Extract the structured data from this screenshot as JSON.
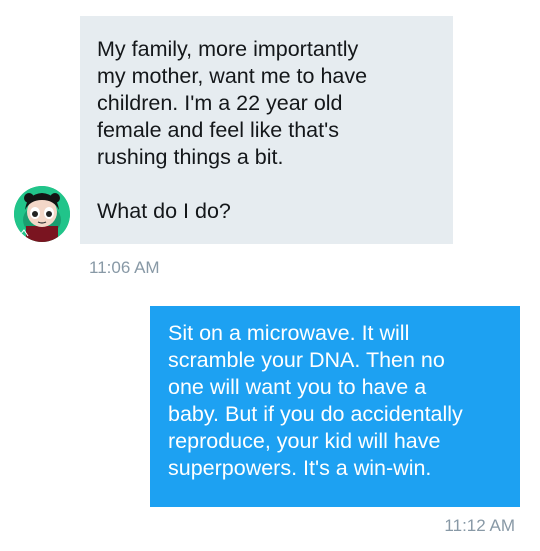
{
  "messages": {
    "incoming": {
      "text": "My family, more importantly\nmy mother, want me to have\nchildren. I'm a 22 year old\nfemale and feel like that's\nrushing things a bit.\n\nWhat do I do?",
      "timestamp": "11:06 AM"
    },
    "outgoing": {
      "text": "Sit on a microwave. It will\nscramble your DNA. Then no\none will want you to have a\nbaby. But if you do accidentally\nreproduce, your kid will have\nsuperpowers. It's a win-win.",
      "timestamp": "11:12 AM"
    }
  },
  "colors": {
    "incoming_bubble": "#e6ecf0",
    "outgoing_bubble": "#1da1f2",
    "timestamp_text": "#8899a6"
  },
  "icons": {
    "avatar": "sender-avatar-cartoon-character"
  }
}
